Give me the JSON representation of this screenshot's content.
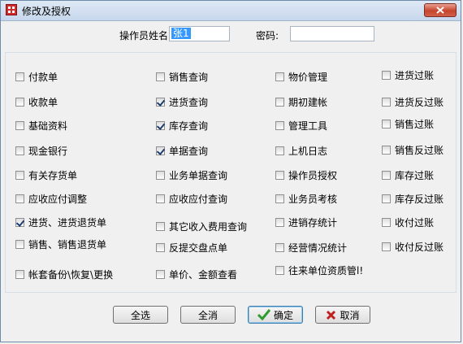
{
  "window": {
    "title": "修改及授权"
  },
  "form": {
    "operator_name_label": "操作员姓名",
    "operator_name_value": "张1",
    "password_label": "密码:",
    "password_value": ""
  },
  "permissions": {
    "col1": [
      {
        "label": "付款单",
        "checked": false
      },
      {
        "label": "收款单",
        "checked": false
      },
      {
        "label": "基础资料",
        "checked": false
      },
      {
        "label": "现金银行",
        "checked": false
      },
      {
        "label": "有关存货单",
        "checked": false
      },
      {
        "label": "应收应付调整",
        "checked": false
      },
      {
        "label": "进货、进货退货单",
        "checked": true
      },
      {
        "label": "销售、销售退货单",
        "checked": false
      },
      {
        "label": "帐套备份\\恢复\\更换",
        "checked": false
      }
    ],
    "col2": [
      {
        "label": "销售查询",
        "checked": false
      },
      {
        "label": "进货查询",
        "checked": true
      },
      {
        "label": "库存查询",
        "checked": true
      },
      {
        "label": "单据查询",
        "checked": true
      },
      {
        "label": "业务单据查询",
        "checked": false
      },
      {
        "label": "应收应付查询",
        "checked": false
      },
      {
        "label": "其它收入费用查询",
        "checked": false
      },
      {
        "label": "反提交盘点单",
        "checked": false
      },
      {
        "label": "单价、金额查看",
        "checked": false
      }
    ],
    "col3": [
      {
        "label": "物价管理",
        "checked": false
      },
      {
        "label": "期初建帐",
        "checked": false
      },
      {
        "label": "管理工具",
        "checked": false
      },
      {
        "label": "上机日志",
        "checked": false
      },
      {
        "label": "操作员授权",
        "checked": false
      },
      {
        "label": "业务员考核",
        "checked": false
      },
      {
        "label": "进销存统计",
        "checked": false
      },
      {
        "label": "经营情况统计",
        "checked": false
      },
      {
        "label": "往来单位资质管l!",
        "checked": false
      }
    ],
    "col4": [
      {
        "label": "进货过账",
        "checked": false
      },
      {
        "label": "进货反过账",
        "checked": false
      },
      {
        "label": "销售过账",
        "checked": false
      },
      {
        "label": "销售反过账",
        "checked": false
      },
      {
        "label": "库存过账",
        "checked": false
      },
      {
        "label": "库存反过账",
        "checked": false
      },
      {
        "label": "收付过账",
        "checked": false
      },
      {
        "label": "收付反过账",
        "checked": false
      }
    ]
  },
  "buttons": {
    "select_all": "全选",
    "clear_all": "全消",
    "ok": "确定",
    "cancel": "取消"
  },
  "colors": {
    "selection": "#3399ff",
    "ok_check": "#2e9b2e",
    "cancel_x": "#c0201f"
  }
}
